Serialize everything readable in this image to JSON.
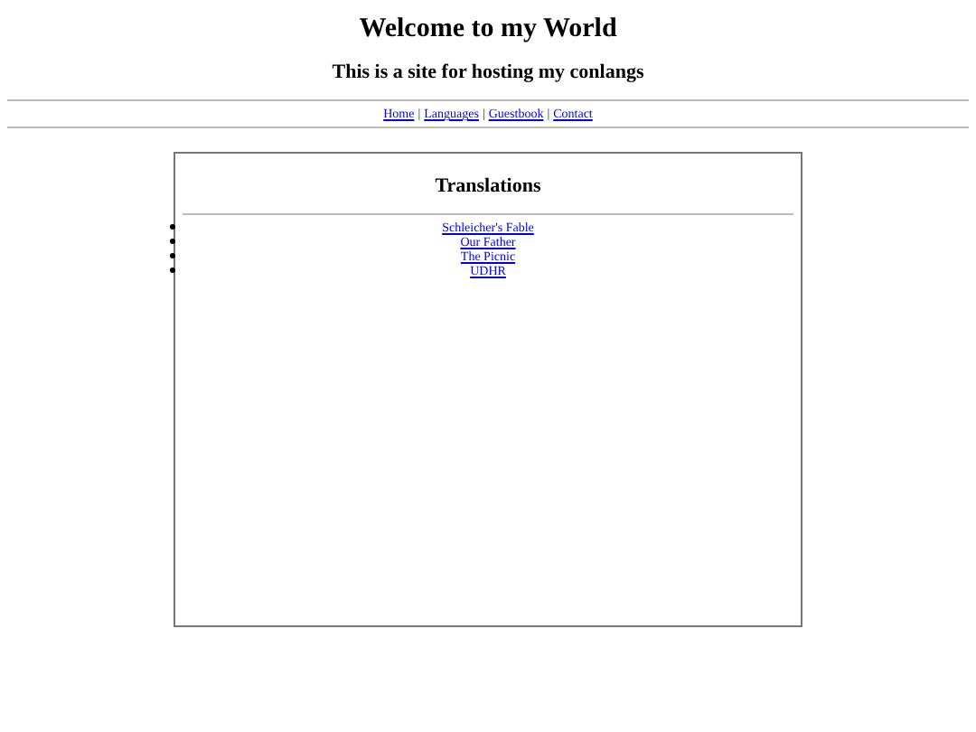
{
  "header": {
    "title": "Welcome to my World",
    "subtitle": "This is a site for hosting my conlangs"
  },
  "nav": {
    "separator": "|",
    "links": [
      "Home",
      "Languages",
      "Guestbook",
      "Contact"
    ]
  },
  "panel": {
    "title": "Translations",
    "links": [
      "Schleicher's Fable",
      "Our Father",
      "The Picnic",
      "UDHR"
    ]
  }
}
